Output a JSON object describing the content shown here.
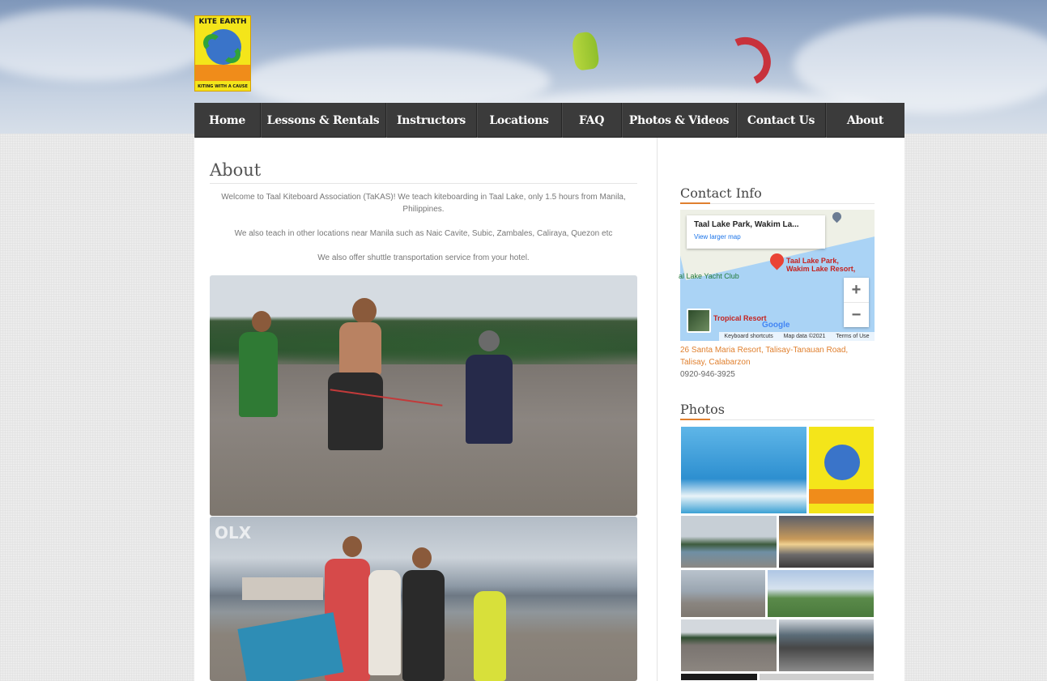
{
  "site": {
    "logo": {
      "top_text": "KITE EARTH",
      "bottom_text": "KITING WITH A CAUSE"
    }
  },
  "nav": {
    "items": [
      {
        "label": "Home"
      },
      {
        "label": "Lessons & Rentals"
      },
      {
        "label": "Instructors"
      },
      {
        "label": "Locations"
      },
      {
        "label": "FAQ"
      },
      {
        "label": "Photos & Videos"
      },
      {
        "label": "Contact Us"
      },
      {
        "label": "About"
      }
    ]
  },
  "main": {
    "title": "About",
    "paragraphs": [
      "Welcome to Taal Kiteboard Association (TaKAS)! We teach kiteboarding in Taal Lake, only 1.5 hours from Manila, Philippines.",
      "We also teach in other locations near Manila such as Naic Cavite, Subic, Zambales, Caliraya, Quezon etc",
      "We also offer shuttle transportation service from your hotel."
    ],
    "photo2_watermark": "OLX"
  },
  "sidebar": {
    "contact": {
      "title": "Contact Info",
      "map": {
        "place_title": "Taal Lake Park, Wakim La...",
        "view_larger": "View larger map",
        "pin_label_1": "Taal Lake Park,",
        "pin_label_2": "Wakim Lake Resort,",
        "yacht_label": "al Lake Yacht Club",
        "tropical_label": "Tropical Resort",
        "google": "Google",
        "shortcuts": "Keyboard shortcuts",
        "map_data": "Map data ©2021",
        "terms": "Terms of Use",
        "zoom_in": "+",
        "zoom_out": "−"
      },
      "address": "26 Santa Maria Resort, Talisay-Tanauan Road, Talisay, Calabarzon",
      "phone": "0920-946-3925"
    },
    "photos": {
      "title": "Photos"
    }
  },
  "colors": {
    "accent": "#e0802f",
    "nav_bg": "#3b3b3b",
    "map_water": "#aad3f5"
  }
}
